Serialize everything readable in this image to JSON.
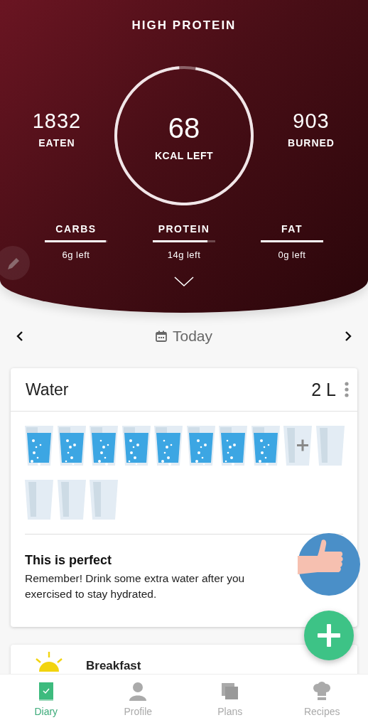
{
  "header": {
    "title": "HIGH PROTEIN",
    "eaten": {
      "value": "1832",
      "label": "EATEN"
    },
    "ring": {
      "value": "68",
      "label": "KCAL LEFT",
      "level": 0.96
    },
    "burned": {
      "value": "903",
      "label": "BURNED"
    },
    "macros": [
      {
        "name": "CARBS",
        "level": 0.98,
        "left": "6g left"
      },
      {
        "name": "PROTEIN",
        "level": 0.88,
        "left": "14g left"
      },
      {
        "name": "FAT",
        "level": 1,
        "left": "0g left"
      }
    ]
  },
  "date_bar": {
    "label": "Today"
  },
  "water": {
    "title": "Water",
    "amount": "2 L",
    "glasses": [
      {
        "kind": "full"
      },
      {
        "kind": "full"
      },
      {
        "kind": "full"
      },
      {
        "kind": "full"
      },
      {
        "kind": "full"
      },
      {
        "kind": "full"
      },
      {
        "kind": "full"
      },
      {
        "kind": "full"
      },
      {
        "kind": "add"
      },
      {
        "kind": "empty"
      },
      {
        "kind": "empty"
      },
      {
        "kind": "empty"
      },
      {
        "kind": "empty"
      }
    ],
    "tip": {
      "title": "This is perfect",
      "text": "Remember! Drink some extra water after you exercised to stay hydrated."
    }
  },
  "meal": {
    "title": "Breakfast"
  },
  "nav": [
    {
      "label": "Diary",
      "selected": true,
      "kind": "diary"
    },
    {
      "label": "Profile",
      "selected": false,
      "kind": "profile"
    },
    {
      "label": "Plans",
      "selected": false,
      "kind": "plans"
    },
    {
      "label": "Recipes",
      "selected": false,
      "kind": "recipes"
    }
  ]
}
